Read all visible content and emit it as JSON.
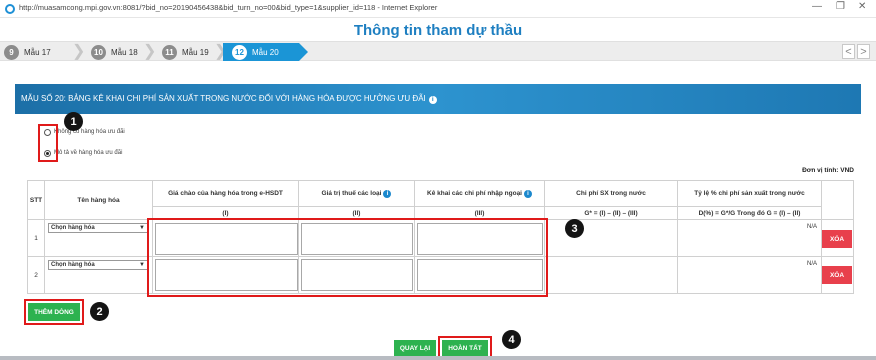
{
  "window": {
    "url": "http://muasamcong.mpi.gov.vn:8081/?bid_no=20190456438&bid_turn_no=00&bid_type=1&supplier_id=118 - Internet Explorer",
    "min_icon": "minimize-icon",
    "max_icon": "maximize-icon",
    "close_icon": "close-icon",
    "min_glyph": "—",
    "max_glyph": "❐",
    "close_glyph": "✕"
  },
  "page_title": "Thông tin tham dự thầu",
  "steps": [
    {
      "num": "9",
      "label": "Mẫu 17",
      "active": false
    },
    {
      "num": "10",
      "label": "Mẫu 18",
      "active": false
    },
    {
      "num": "11",
      "label": "Mẫu 19",
      "active": false
    },
    {
      "num": "12",
      "label": "Mẫu 20",
      "active": true
    }
  ],
  "step_sep": "❯",
  "nav": {
    "prev": "<",
    "next": ">"
  },
  "section": {
    "title": "MẪU SỐ 20: BẢNG KÊ KHAI CHI PHÍ SẢN XUẤT TRONG NƯỚC ĐỐI VỚI HÀNG HÓA ĐƯỢC HƯỞNG ƯU ĐÃI",
    "info_glyph": "i"
  },
  "radios": [
    {
      "label": "Không có hàng hóa ưu đãi",
      "checked": false
    },
    {
      "label": "Mô tả về hàng hóa ưu đãi",
      "checked": true
    }
  ],
  "unit_label": "Đơn vị tính: VND",
  "table": {
    "headers": {
      "stt": "STT",
      "item": "Tên hàng hóa",
      "bid_price": "Giá chào của hàng hóa trong e-HSDT",
      "tax": "Giá trị thuế các loại",
      "import_cost": "Kê khai các chi phí nhập ngoại",
      "domestic_cost": "Chi phí SX trong nước",
      "ratio": "Tỷ lệ % chi phí sản xuất trong nước"
    },
    "subheaders": {
      "bid_price": "(I)",
      "tax": "(II)",
      "import_cost": "(III)",
      "domestic_cost": "G* = (I) – (II) – (III)",
      "ratio": "D(%) = G*/G Trong đó G = (I) – (II)"
    },
    "info_glyph": "i",
    "rows": [
      {
        "stt": "1",
        "select_value": "Chọn hàng hóa",
        "ratio_value": "N/A",
        "delete_label": "XÓA"
      },
      {
        "stt": "2",
        "select_value": "Chọn hàng hóa",
        "ratio_value": "N/A",
        "delete_label": "XÓA"
      }
    ],
    "dropdown_glyph": "▼"
  },
  "buttons": {
    "add_row": "THÊM DÒNG",
    "back": "QUAY LẠI",
    "finish": "HOÀN TẤT"
  },
  "markers": [
    "1",
    "2",
    "3",
    "4"
  ],
  "colors": {
    "accent": "#1b95d6",
    "title": "#1e7fc1",
    "green": "#2db24f",
    "delete": "#e8404c",
    "annotation_red": "#e01a1a"
  }
}
